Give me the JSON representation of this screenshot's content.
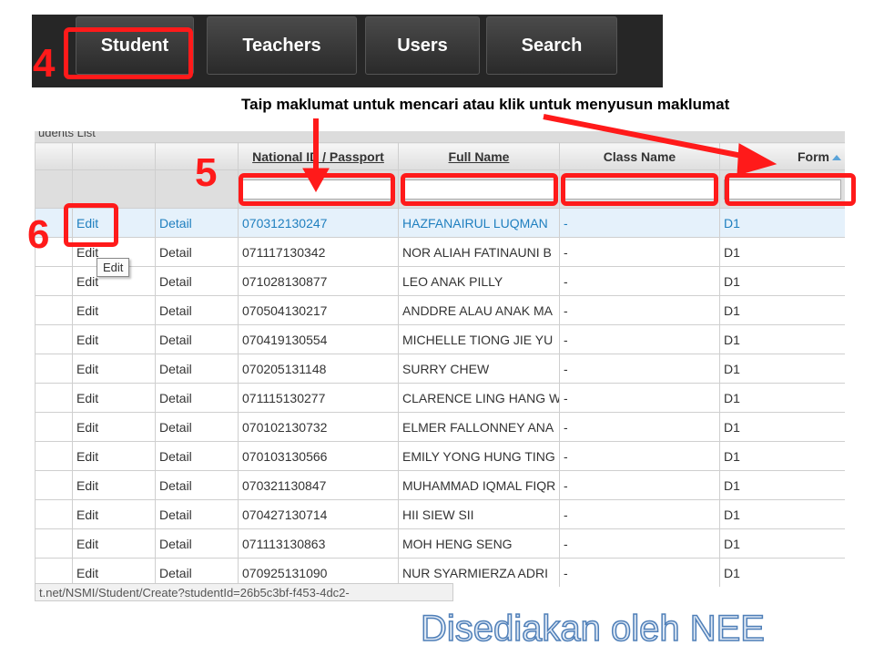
{
  "nav": {
    "tabs": [
      {
        "label": "Student"
      },
      {
        "label": "Teachers"
      },
      {
        "label": "Users"
      },
      {
        "label": "Search"
      }
    ]
  },
  "annotations": {
    "step4": "4",
    "step5": "5",
    "step6": "6",
    "instruction": "Taip maklumat untuk mencari atau klik untuk menyusun maklumat",
    "credit": "Disediakan oleh NEE",
    "accent_color": "#ff1a1a"
  },
  "grid": {
    "title": "udents List",
    "columns": [
      "",
      "",
      "National ID / Passport",
      "Full Name",
      "Class Name",
      "Form"
    ],
    "sort_icon": "sort-ascending-icon",
    "rows": [
      {
        "edit": "Edit",
        "detail": "Detail",
        "id": "070312130247",
        "name": "HAZFANAIRUL LUQMAN",
        "class": "-",
        "form": "D1"
      },
      {
        "edit": "Edit",
        "detail": "Detail",
        "id": "071117130342",
        "name": "NOR ALIAH FATINAUNI B",
        "class": "-",
        "form": "D1"
      },
      {
        "edit": "Edit",
        "detail": "Detail",
        "id": "071028130877",
        "name": "LEO ANAK PILLY",
        "class": "-",
        "form": "D1"
      },
      {
        "edit": "Edit",
        "detail": "Detail",
        "id": "070504130217",
        "name": "ANDDRE ALAU ANAK MA",
        "class": "-",
        "form": "D1"
      },
      {
        "edit": "Edit",
        "detail": "Detail",
        "id": "070419130554",
        "name": "MICHELLE TIONG JIE YU",
        "class": "-",
        "form": "D1"
      },
      {
        "edit": "Edit",
        "detail": "Detail",
        "id": "070205131148",
        "name": "SURRY CHEW",
        "class": "-",
        "form": "D1"
      },
      {
        "edit": "Edit",
        "detail": "Detail",
        "id": "071115130277",
        "name": "CLARENCE LING HANG W",
        "class": "-",
        "form": "D1"
      },
      {
        "edit": "Edit",
        "detail": "Detail",
        "id": "070102130732",
        "name": "ELMER FALLONNEY ANA",
        "class": "-",
        "form": "D1"
      },
      {
        "edit": "Edit",
        "detail": "Detail",
        "id": "070103130566",
        "name": "EMILY YONG HUNG TING",
        "class": "-",
        "form": "D1"
      },
      {
        "edit": "Edit",
        "detail": "Detail",
        "id": "070321130847",
        "name": "MUHAMMAD IQMAL FIQR",
        "class": "-",
        "form": "D1"
      },
      {
        "edit": "Edit",
        "detail": "Detail",
        "id": "070427130714",
        "name": "HII SIEW SII",
        "class": "-",
        "form": "D1"
      },
      {
        "edit": "Edit",
        "detail": "Detail",
        "id": "071113130863",
        "name": "MOH HENG SENG",
        "class": "-",
        "form": "D1"
      },
      {
        "edit": "Edit",
        "detail": "Detail",
        "id": "070925131090",
        "name": "NUR SYARMIERZA ADRI",
        "class": "-",
        "form": "D1"
      }
    ]
  },
  "tooltip": "Edit",
  "status_url": "t.net/NSMI/Student/Create?studentId=26b5c3bf-f453-4dc2-"
}
